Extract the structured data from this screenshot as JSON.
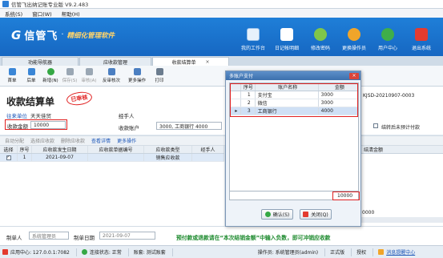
{
  "window": {
    "title": "信管飞出纳记账专业版 V9.2.483"
  },
  "menu": [
    "系统(S)",
    "窗口(W)",
    "帮助(H)"
  ],
  "brand": {
    "mark": "G",
    "name": "信管飞",
    "slogan": "精细化管理软件"
  },
  "top_tools": [
    {
      "label": "我的工作台",
      "icon": "workstation-icon",
      "color": "#e7f1fb"
    },
    {
      "label": "日记帐明细",
      "icon": "ledger-icon",
      "color": "#ffffff"
    },
    {
      "label": "修改密码",
      "icon": "key-icon",
      "color": "#7fc64a"
    },
    {
      "label": "更换操作员",
      "icon": "user-icon",
      "color": "#f0a52a"
    },
    {
      "label": "用户中心",
      "icon": "globe-icon",
      "color": "#3fae4a"
    },
    {
      "label": "退出系统",
      "icon": "power-icon",
      "color": "#e33b2f"
    }
  ],
  "tabs": [
    {
      "label": "功能导航器"
    },
    {
      "label": "应收款管理"
    },
    {
      "label": "收款结算单",
      "close": "×"
    }
  ],
  "toolbar": [
    {
      "label": "首单",
      "icon": "first-icon",
      "color": "#3a86d6",
      "disabled": false
    },
    {
      "label": "后单",
      "icon": "next-icon",
      "color": "#3a86d6",
      "disabled": false
    },
    {
      "label": "新增(N)",
      "icon": "add-icon",
      "color": "#35a845",
      "disabled": false
    },
    {
      "label": "保存(S)",
      "icon": "save-icon",
      "color": "#9aa7b4",
      "disabled": true
    },
    {
      "label": "审核(A)",
      "icon": "approve-icon",
      "color": "#9aa7b4",
      "disabled": true
    },
    {
      "label": "反审核次",
      "icon": "unapprove-icon",
      "color": "#4b7fc1",
      "disabled": false
    },
    {
      "label": "更多操作",
      "icon": "more-icon",
      "color": "#4b7fc1",
      "disabled": false
    },
    {
      "label": "打印",
      "icon": "print-icon",
      "color": "#6b7c8e",
      "disabled": false
    }
  ],
  "form": {
    "title": "收款结算单",
    "stamp": "已审核",
    "customer_label": "往来单位",
    "customer_value": "天天佳贸",
    "handler_label": "经手人",
    "amount_label": "收款金额",
    "amount_value": "10000",
    "account_label": "收款账户",
    "account_value": "3000, 工商银行 4000",
    "doc_no": "KJSD-20210907-0003",
    "checkbox_label": "结转后未预计付款"
  },
  "subbar": [
    "自动分配",
    "选择应收款",
    "删除应收款",
    "查看详情",
    "更多操作"
  ],
  "grid": {
    "columns": [
      "选择",
      "序号",
      "应收款发生日期",
      "应收款单据编号",
      "应收款类型",
      "经手人"
    ],
    "rows": [
      {
        "select": "✓",
        "no": "1",
        "date": "2021-09-07",
        "doc": "",
        "type": "销售应收款",
        "handler": ""
      }
    ]
  },
  "right_panel": {
    "header": "结清金额",
    "value": "0000"
  },
  "footer": {
    "maker_label": "制单人",
    "maker_value": "系统管理员",
    "date_label": "制单日期",
    "date_value": "2021-09-07",
    "hint": "预付款或退款请在“本次结销金额”中输入负数，即可冲销应收款"
  },
  "statusbar": {
    "app_center": "应用中心: 127.0.0.1:7082",
    "conn": "连接状态: 正常",
    "book": "账套: 测试账套",
    "operator": "操作员: 系统管理员(admin)",
    "edition": "正式版",
    "serial": "授权",
    "msg": "消息提醒中心"
  },
  "dialog": {
    "title": "多账户支付",
    "close": "×",
    "columns": [
      "序号",
      "账户名称",
      "金额"
    ],
    "rows": [
      {
        "no": "1",
        "account": "支付宝",
        "amount": "3000"
      },
      {
        "no": "2",
        "account": "微信",
        "amount": "3000"
      },
      {
        "no": "3",
        "account": "工商银行",
        "amount": "4000"
      }
    ],
    "total": "10000",
    "ok": "确认(S)",
    "cancel": "关闭(Q)"
  }
}
